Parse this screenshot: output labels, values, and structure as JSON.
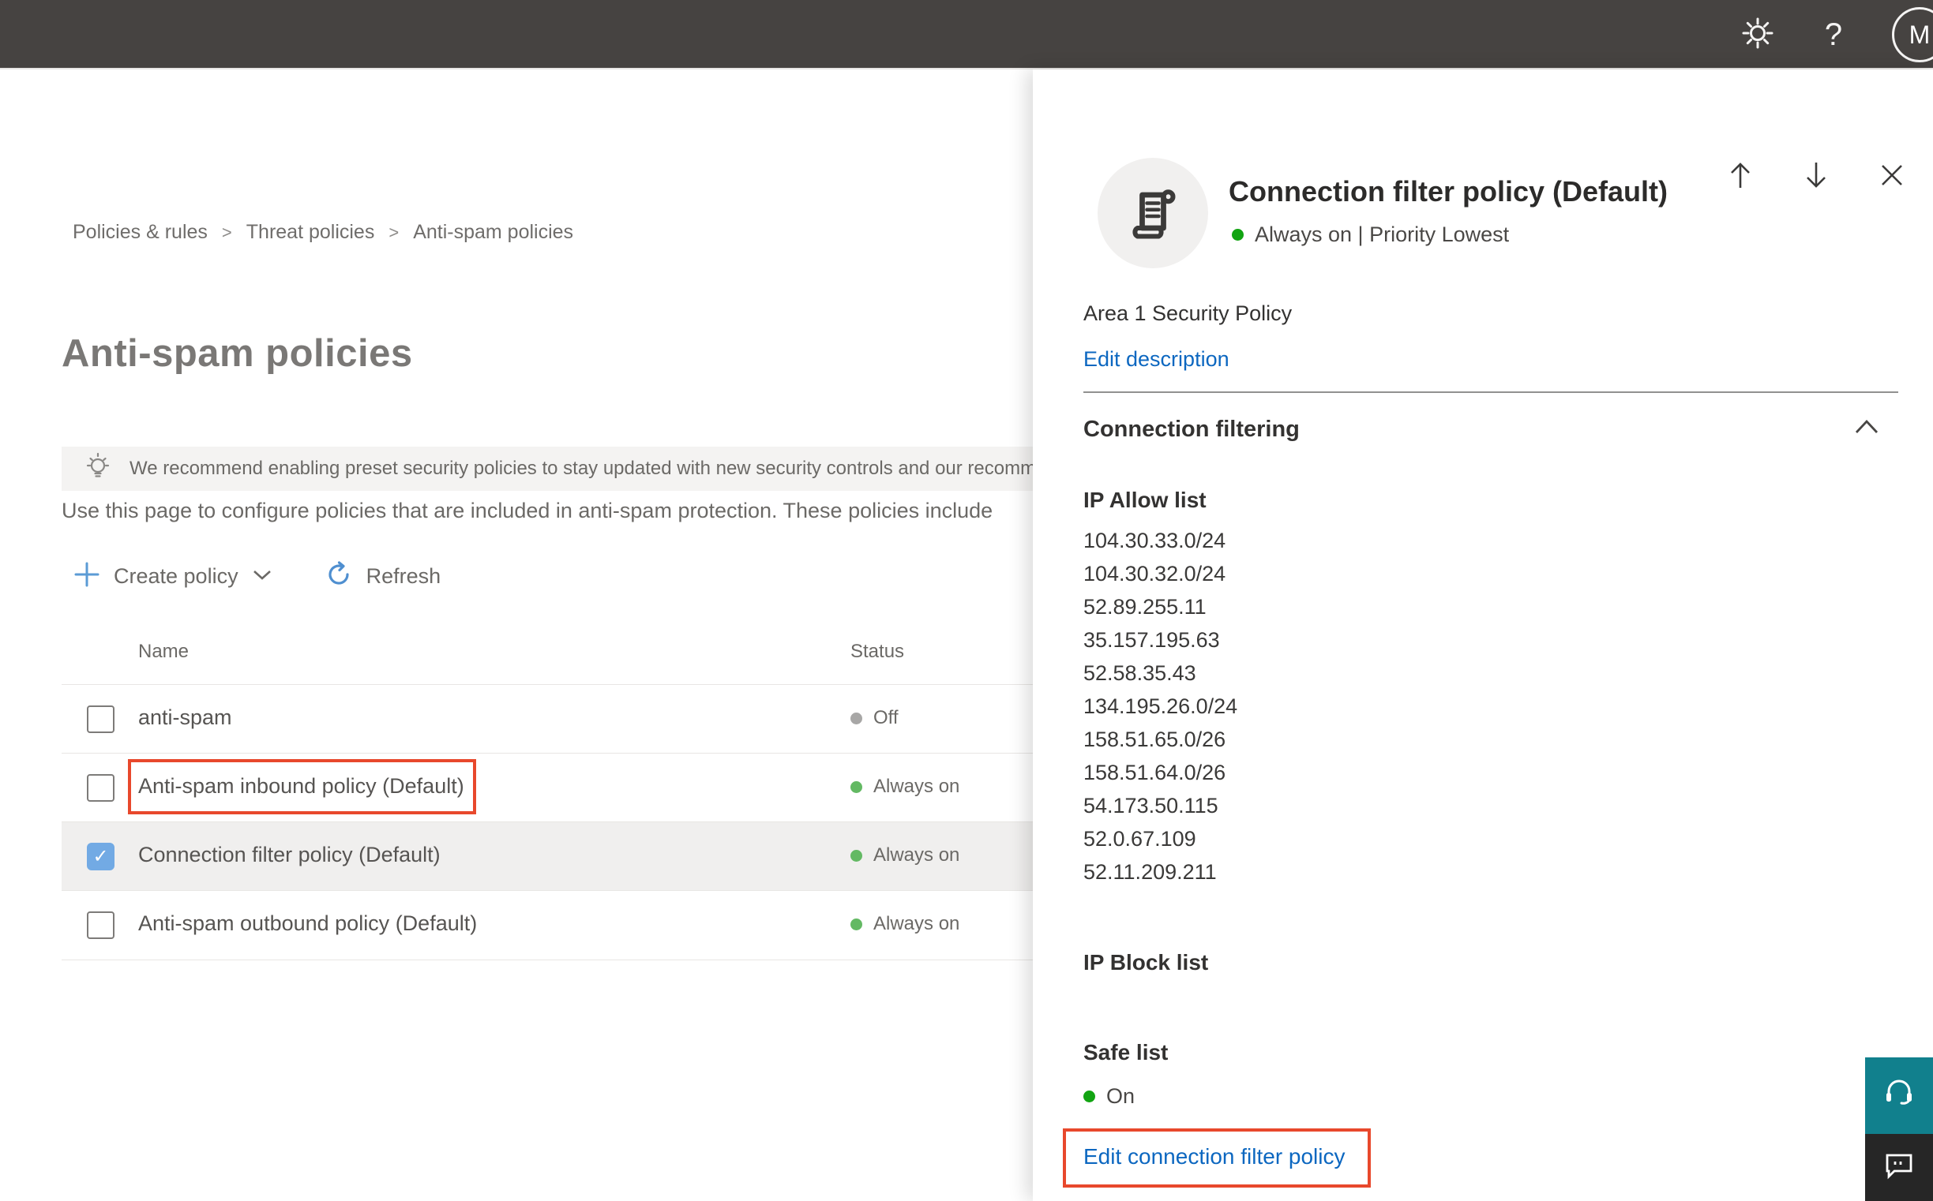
{
  "topbar": {
    "help_label": "?",
    "avatar_initial": "M"
  },
  "breadcrumb": {
    "separator": ">",
    "items": [
      "Policies & rules",
      "Threat policies",
      "Anti-spam policies"
    ]
  },
  "page": {
    "title": "Anti-spam policies",
    "banner_text": "We recommend enabling preset security policies to stay updated with new security controls and our recomme",
    "description": "Use this page to configure policies that are included in anti-spam protection. These policies include"
  },
  "toolbar": {
    "create_policy_label": "Create policy",
    "refresh_label": "Refresh"
  },
  "table": {
    "columns": {
      "name": "Name",
      "status": "Status"
    },
    "rows": [
      {
        "name": "anti-spam",
        "status": "Off",
        "checked": false,
        "selected": false
      },
      {
        "name": "Anti-spam inbound policy (Default)",
        "status": "Always on",
        "checked": false,
        "selected": false
      },
      {
        "name": "Connection filter policy (Default)",
        "status": "Always on",
        "checked": true,
        "selected": true
      },
      {
        "name": "Anti-spam outbound policy (Default)",
        "status": "Always on",
        "checked": false,
        "selected": false
      }
    ],
    "checkmark": "✓"
  },
  "panel": {
    "title": "Connection filter policy (Default)",
    "status_line": "Always on | Priority Lowest",
    "description": "Area 1 Security Policy",
    "edit_description_label": "Edit description",
    "section_title": "Connection filtering",
    "ip_allow_title": "IP Allow list",
    "ip_allow_list": [
      "104.30.33.0/24",
      "104.30.32.0/24",
      "52.89.255.11",
      "35.157.195.63",
      "52.58.35.43",
      "134.195.26.0/24",
      "158.51.65.0/26",
      "158.51.64.0/26",
      "54.173.50.115",
      "52.0.67.109",
      "52.11.209.211"
    ],
    "ip_block_title": "IP Block list",
    "safe_list_title": "Safe list",
    "safe_list_status": "On",
    "edit_link_label": "Edit connection filter policy"
  },
  "colors": {
    "topbar": "#464341",
    "accent_blue": "#0c67c0",
    "annotation_red": "#e8482c",
    "status_green_row": "#63b963",
    "status_green_panel": "#12a412",
    "status_gray": "#a8a7a6",
    "checkbox_blue": "#72aae4",
    "support_teal": "#11808d",
    "feedback_dark": "#262626"
  }
}
